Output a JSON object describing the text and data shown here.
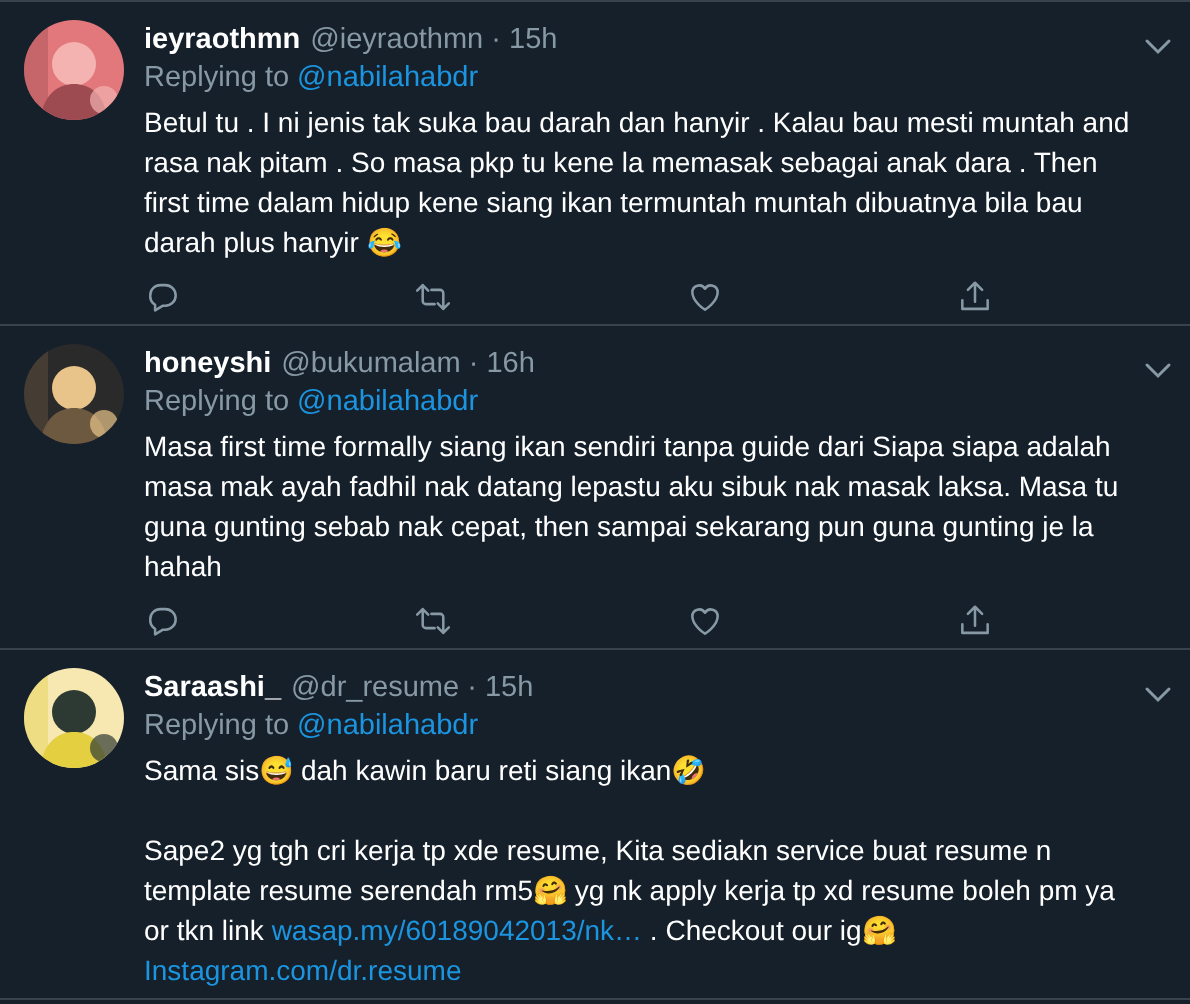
{
  "tweets": [
    {
      "name": "ieyraothmn",
      "meta": "@ieyraothmn · 15h",
      "replying_label": "Replying to",
      "reply_target": "@nabilahabdr",
      "actions": [
        {
          "kind": "reply"
        },
        {
          "kind": "retweet"
        },
        {
          "kind": "like"
        },
        {
          "kind": "share"
        }
      ],
      "body": [
        {
          "kind": "text",
          "text": "Betul tu . I ni jenis tak suka bau darah dan hanyir . Kalau bau mesti muntah and rasa nak pitam . So masa pkp tu kene la memasak sebagai anak dara . Then first time dalam hidup kene siang ikan termuntah muntah dibuatnya bila bau darah plus hanyir 😂"
        }
      ]
    },
    {
      "name": "honeyshi",
      "meta": "@bukumalam · 16h",
      "replying_label": "Replying to",
      "reply_target": "@nabilahabdr",
      "actions": [
        {
          "kind": "reply"
        },
        {
          "kind": "retweet"
        },
        {
          "kind": "like"
        },
        {
          "kind": "share"
        }
      ],
      "body": [
        {
          "kind": "text",
          "text": "Masa first time formally siang ikan sendiri tanpa guide dari Siapa siapa adalah masa mak ayah fadhil nak datang lepastu aku sibuk nak masak laksa. Masa tu guna gunting sebab nak cepat, then sampai sekarang pun guna gunting je la hahah"
        }
      ]
    },
    {
      "name": "Saraashi_",
      "meta": "@dr_resume · 15h",
      "replying_label": "Replying to",
      "reply_target": "@nabilahabdr",
      "body": [
        {
          "kind": "text",
          "text": "Sama sis😅 dah kawin baru reti siang ikan🤣\n\nSape2 yg tgh cri kerja tp xde resume, Kita sediakn service buat resume n template resume serendah rm5🤗 yg nk apply kerja tp xd resume boleh pm ya or tkn link "
        },
        {
          "kind": "link",
          "text": "wasap.my/60189042013/nk…"
        },
        {
          "kind": "text",
          "text": " . Checkout our ig🤗 "
        },
        {
          "kind": "link",
          "text": "Instagram.com/dr.resume"
        }
      ]
    }
  ]
}
